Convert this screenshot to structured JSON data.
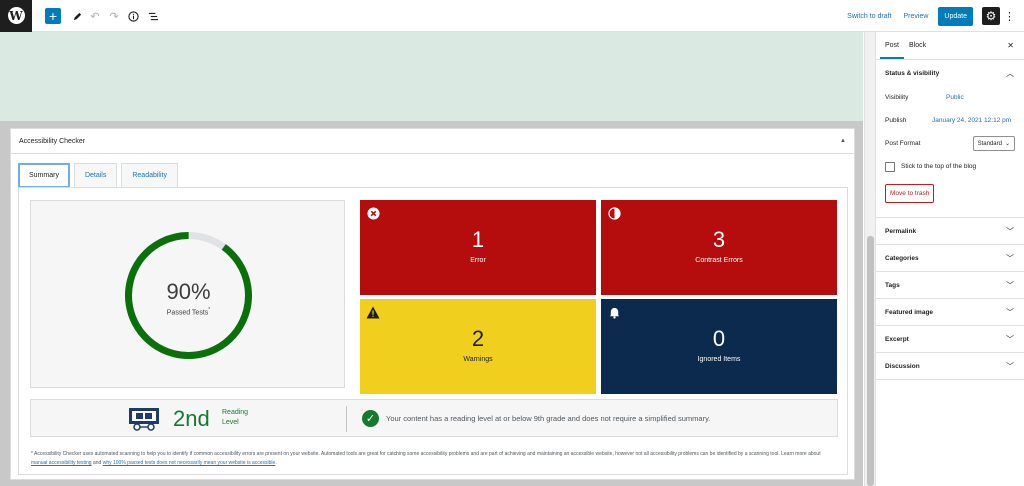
{
  "topbar": {
    "switch_to_draft": "Switch to draft",
    "preview": "Preview",
    "update": "Update"
  },
  "metabox": {
    "title": "Accessibility Checker",
    "tabs": [
      {
        "label": "Summary",
        "active": true
      },
      {
        "label": "Details",
        "active": false
      },
      {
        "label": "Readability",
        "active": false
      }
    ]
  },
  "summary": {
    "passed_percent": 90,
    "passed_display": "90%",
    "passed_label": "Passed Tests",
    "passed_mark": "*",
    "tiles": {
      "error": {
        "count": "1",
        "label": "Error",
        "color": "#b50d0d"
      },
      "contrast": {
        "count": "3",
        "label": "Contrast Errors",
        "color": "#b50d0d"
      },
      "warnings": {
        "count": "2",
        "label": "Warnings",
        "color": "#f0cf1e"
      },
      "ignored": {
        "count": "0",
        "label": "Ignored Items",
        "color": "#0b2a4e"
      }
    },
    "reading": {
      "grade": "2nd",
      "level_line1": "Reading",
      "level_line2": "Level",
      "message": "Your content has a reading level at or below 9th grade and does not require a simplified summary."
    },
    "footnote": {
      "text1": "* Accessibility Checker uses automated scanning to help you to identify if common accessibility errors are present on your website. Automated tools are great for catching some accessibility problems and are part of achieving and maintaining an accessible website, however not all accessibility problems can be identified by a scanning tool. Learn more about ",
      "link1": "manual accessibility testing",
      "text2": " and ",
      "link2": "why 100% passed tests does not necessarily mean your website is accessible",
      "text3": "."
    }
  },
  "sidebar": {
    "tab_post": "Post",
    "tab_block": "Block",
    "status_title": "Status & visibility",
    "visibility_label": "Visibility",
    "visibility_value": "Public",
    "publish_label": "Publish",
    "publish_value": "January 24, 2021 12:12 pm",
    "format_label": "Post Format",
    "format_value": "Standard",
    "sticky_label": "Stick to the top of the blog",
    "trash_label": "Move to trash",
    "sections": [
      "Permalink",
      "Categories",
      "Tags",
      "Featured image",
      "Excerpt",
      "Discussion"
    ]
  },
  "colors": {
    "accent": "#007cba",
    "success": "#147a2e"
  }
}
